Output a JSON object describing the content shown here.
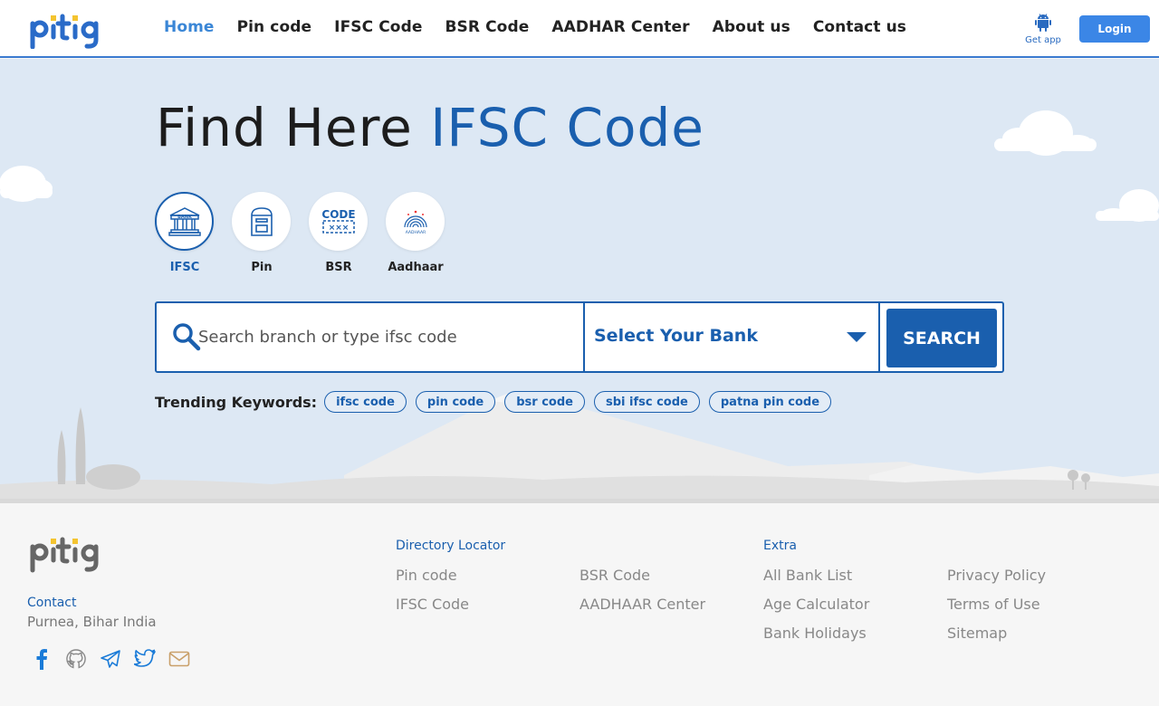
{
  "header": {
    "logo_text": "pitig",
    "nav": [
      {
        "label": "Home",
        "active": true
      },
      {
        "label": "Pin code"
      },
      {
        "label": "IFSC Code"
      },
      {
        "label": "BSR Code"
      },
      {
        "label": "AADHAR Center"
      },
      {
        "label": "About us"
      },
      {
        "label": "Contact us"
      }
    ],
    "get_app_label": "Get app",
    "login_label": "Login"
  },
  "hero": {
    "title_main": "Find Here ",
    "title_accent": "IFSC Code",
    "categories": [
      {
        "label": "IFSC",
        "icon": "bank-icon",
        "active": true
      },
      {
        "label": "Pin",
        "icon": "post-box-icon"
      },
      {
        "label": "BSR",
        "icon": "code-icon"
      },
      {
        "label": "Aadhaar",
        "icon": "aadhaar-icon"
      }
    ],
    "search_placeholder": "Search branch or type ifsc code",
    "bank_select_label": "Select Your Bank",
    "search_button": "SEARCH",
    "trending_label": "Trending Keywords:",
    "trending": [
      "ifsc code",
      "pin code",
      "bsr code",
      "sbi ifsc code",
      "patna pin code"
    ]
  },
  "footer": {
    "logo_text": "pitig",
    "contact_heading": "Contact",
    "contact_location": "Purnea, Bihar India",
    "socials": [
      "facebook-icon",
      "github-icon",
      "telegram-icon",
      "twitter-icon",
      "mail-icon"
    ],
    "directory_heading": "Directory Locator",
    "directory_links": [
      "Pin code",
      "IFSC Code",
      "BSR Code",
      "AADHAAR Center"
    ],
    "extra_heading": "Extra",
    "extra_links": [
      "All Bank List",
      "Age Calculator",
      "Bank Holidays",
      "Privacy Policy",
      "Terms of Use",
      "Sitemap"
    ]
  },
  "colors": {
    "brand_blue": "#1a5fae",
    "nav_active": "#3a86d6",
    "login_bg": "#3b86e6",
    "hero_bg": "#dde8f4"
  }
}
